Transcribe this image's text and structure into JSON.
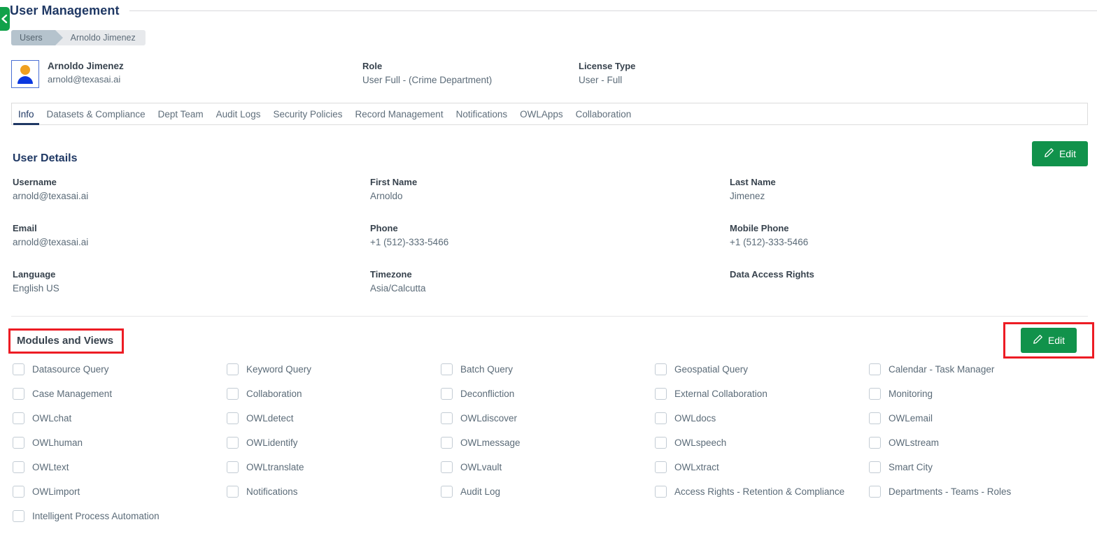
{
  "header": {
    "title": "User Management",
    "back_icon": "chevron-left-icon"
  },
  "breadcrumb": {
    "items": [
      "Users",
      "Arnoldo Jimenez"
    ]
  },
  "identity": {
    "avatar_icon": "user-avatar-icon",
    "name": "Arnoldo Jimenez",
    "email": "arnold@texasai.ai",
    "role_label": "Role",
    "role_value": "User Full - (Crime Department)",
    "license_label": "License Type",
    "license_value": "User - Full"
  },
  "tabs": [
    {
      "label": "Info",
      "active": true
    },
    {
      "label": "Datasets & Compliance",
      "active": false
    },
    {
      "label": "Dept Team",
      "active": false
    },
    {
      "label": "Audit Logs",
      "active": false
    },
    {
      "label": "Security Policies",
      "active": false
    },
    {
      "label": "Record Management",
      "active": false
    },
    {
      "label": "Notifications",
      "active": false
    },
    {
      "label": "OWLApps",
      "active": false
    },
    {
      "label": "Collaboration",
      "active": false
    }
  ],
  "user_details": {
    "title": "User Details",
    "edit_label": "Edit",
    "edit_icon": "pencil-icon",
    "fields": [
      {
        "label": "Username",
        "value": "arnold@texasai.ai"
      },
      {
        "label": "First Name",
        "value": "Arnoldo"
      },
      {
        "label": "Last Name",
        "value": "Jimenez"
      },
      {
        "label": "Email",
        "value": "arnold@texasai.ai"
      },
      {
        "label": "Phone",
        "value": "+1 (512)-333-5466"
      },
      {
        "label": "Mobile Phone",
        "value": "+1 (512)-333-5466"
      },
      {
        "label": "Language",
        "value": "English US"
      },
      {
        "label": "Timezone",
        "value": "Asia/Calcutta"
      },
      {
        "label": "Data Access Rights",
        "value": ""
      }
    ]
  },
  "modules": {
    "title": "Modules and Views",
    "edit_label": "Edit",
    "edit_icon": "pencil-icon",
    "highlight_color": "#ED1C24",
    "items": [
      {
        "label": "Datasource Query",
        "checked": false
      },
      {
        "label": "Keyword Query",
        "checked": false
      },
      {
        "label": "Batch Query",
        "checked": false
      },
      {
        "label": "Geospatial Query",
        "checked": false
      },
      {
        "label": "Calendar - Task Manager",
        "checked": false
      },
      {
        "label": "Case Management",
        "checked": false
      },
      {
        "label": "Collaboration",
        "checked": false
      },
      {
        "label": "Deconfliction",
        "checked": false
      },
      {
        "label": "External Collaboration",
        "checked": false
      },
      {
        "label": "Monitoring",
        "checked": false
      },
      {
        "label": "OWLchat",
        "checked": false
      },
      {
        "label": "OWLdetect",
        "checked": false
      },
      {
        "label": "OWLdiscover",
        "checked": false
      },
      {
        "label": "OWLdocs",
        "checked": false
      },
      {
        "label": "OWLemail",
        "checked": false
      },
      {
        "label": "OWLhuman",
        "checked": false
      },
      {
        "label": "OWLidentify",
        "checked": false
      },
      {
        "label": "OWLmessage",
        "checked": false
      },
      {
        "label": "OWLspeech",
        "checked": false
      },
      {
        "label": "OWLstream",
        "checked": false
      },
      {
        "label": "OWLtext",
        "checked": false
      },
      {
        "label": "OWLtranslate",
        "checked": false
      },
      {
        "label": "OWLvault",
        "checked": false
      },
      {
        "label": "OWLxtract",
        "checked": false
      },
      {
        "label": "Smart City",
        "checked": false
      },
      {
        "label": "OWLimport",
        "checked": false
      },
      {
        "label": "Notifications",
        "checked": false
      },
      {
        "label": "Audit Log",
        "checked": false
      },
      {
        "label": "Access Rights - Retention & Compliance",
        "checked": false
      },
      {
        "label": "Departments - Teams - Roles",
        "checked": false
      },
      {
        "label": "Intelligent Process Automation",
        "checked": false
      }
    ]
  },
  "theme": {
    "accent_green": "#11924B",
    "title_navy": "#1f3864",
    "text_gray": "#5b6b78"
  }
}
